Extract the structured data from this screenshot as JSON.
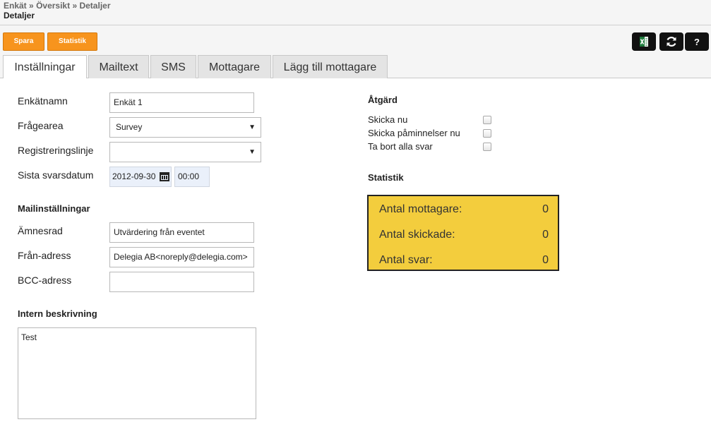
{
  "header": {
    "breadcrumb": [
      "Enkät",
      "Översikt",
      "Detaljer"
    ],
    "separator": "»",
    "title": "Detaljer"
  },
  "toolbar": {
    "save_label": "Spara",
    "stats_label": "Statistik",
    "help_label": "?"
  },
  "tabs": [
    {
      "label": "Inställningar",
      "active": true
    },
    {
      "label": "Mailtext"
    },
    {
      "label": "SMS"
    },
    {
      "label": "Mottagare"
    },
    {
      "label": "Lägg till mottagare"
    }
  ],
  "settings": {
    "survey_name_label": "Enkätnamn",
    "survey_name_value": "Enkät 1",
    "question_area_label": "Frågearea",
    "question_area_value": "Survey",
    "registration_line_label": "Registreringslinje",
    "registration_line_value": "",
    "last_date_label": "Sista svarsdatum",
    "last_date_value": "2012-09-30",
    "last_time_value": "00:00"
  },
  "mail": {
    "section_title": "Mailinställningar",
    "subject_label": "Ämnesrad",
    "subject_value": "Utvärdering från eventet",
    "from_label": "Från-adress",
    "from_value": "Delegia AB<noreply@delegia.com>",
    "bcc_label": "BCC-adress",
    "bcc_value": ""
  },
  "internal": {
    "section_title": "Intern beskrivning",
    "value": "Test"
  },
  "actions": {
    "section_title": "Åtgärd",
    "items": [
      {
        "label": "Skicka nu",
        "checked": false
      },
      {
        "label": "Skicka påminnelser nu",
        "checked": false
      },
      {
        "label": "Ta bort alla svar",
        "checked": false
      }
    ]
  },
  "statistics": {
    "section_title": "Statistik",
    "rows": [
      {
        "label": "Antal mottagare:",
        "value": "0"
      },
      {
        "label": "Antal skickade:",
        "value": "0"
      },
      {
        "label": "Antal svar:",
        "value": "0"
      }
    ]
  },
  "colors": {
    "accent_orange": "#f7941d",
    "stats_yellow": "#f3cd3d",
    "icon_button_bg": "#111111"
  }
}
